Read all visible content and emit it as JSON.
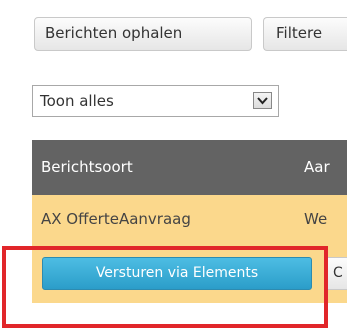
{
  "toolbar": {
    "fetch_label": "Berichten ophalen",
    "filter_label": "Filtere"
  },
  "filter": {
    "selected": "Toon alles",
    "icon": "chevron-down-icon"
  },
  "table": {
    "headers": [
      "Berichtsoort",
      "Aar"
    ],
    "rows": [
      [
        "AX OfferteAanvraag",
        "We"
      ]
    ],
    "actions": {
      "send_label": "Versturen via Elements",
      "next_label": "C"
    }
  },
  "colors": {
    "header_bg": "#636363",
    "row_bg": "#fbd88c",
    "send_button": "#2b9dc9",
    "highlight": "#e1262a"
  }
}
